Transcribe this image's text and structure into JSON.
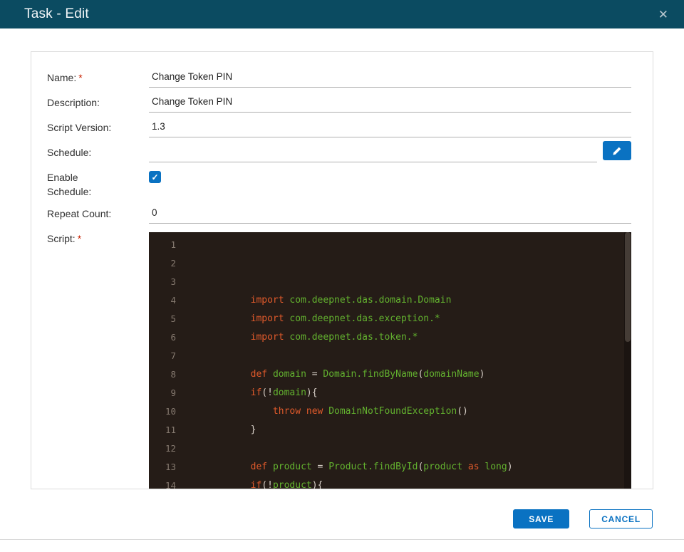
{
  "modal": {
    "title": "Task - Edit",
    "close_glyph": "✕"
  },
  "form": {
    "required_marker": "*",
    "name": {
      "label": "Name:",
      "required": true,
      "value": "Change Token PIN"
    },
    "description": {
      "label": "Description:",
      "value": "Change Token PIN"
    },
    "script_version": {
      "label": "Script Version:",
      "value": "1.3"
    },
    "schedule": {
      "label": "Schedule:",
      "value": ""
    },
    "enable_schedule": {
      "label": "Enable Schedule:",
      "checked": true,
      "check_glyph": "✓"
    },
    "repeat_count": {
      "label": "Repeat Count:",
      "value": "0"
    },
    "script": {
      "label": "Script:",
      "required": true
    }
  },
  "editor": {
    "lines": [
      {
        "num": "1",
        "segments": []
      },
      {
        "num": "2",
        "segments": []
      },
      {
        "num": "3",
        "segments": []
      },
      {
        "num": "4",
        "segments": [
          {
            "t": "p",
            "s": "        "
          },
          {
            "t": "k",
            "s": "import"
          },
          {
            "t": "p",
            "s": " "
          },
          {
            "t": "i",
            "s": "com.deepnet.das.domain.Domain"
          }
        ]
      },
      {
        "num": "5",
        "segments": [
          {
            "t": "p",
            "s": "        "
          },
          {
            "t": "k",
            "s": "import"
          },
          {
            "t": "p",
            "s": " "
          },
          {
            "t": "i",
            "s": "com.deepnet.das.exception.*"
          }
        ]
      },
      {
        "num": "6",
        "segments": [
          {
            "t": "p",
            "s": "        "
          },
          {
            "t": "k",
            "s": "import"
          },
          {
            "t": "p",
            "s": " "
          },
          {
            "t": "i",
            "s": "com.deepnet.das.token.*"
          }
        ]
      },
      {
        "num": "7",
        "segments": []
      },
      {
        "num": "8",
        "segments": [
          {
            "t": "p",
            "s": "        "
          },
          {
            "t": "k",
            "s": "def"
          },
          {
            "t": "p",
            "s": " "
          },
          {
            "t": "i",
            "s": "domain"
          },
          {
            "t": "p",
            "s": " = "
          },
          {
            "t": "i",
            "s": "Domain.findByName"
          },
          {
            "t": "p",
            "s": "("
          },
          {
            "t": "i",
            "s": "domainName"
          },
          {
            "t": "p",
            "s": ")"
          }
        ]
      },
      {
        "num": "9",
        "segments": [
          {
            "t": "p",
            "s": "        "
          },
          {
            "t": "k",
            "s": "if"
          },
          {
            "t": "p",
            "s": "(!"
          },
          {
            "t": "i",
            "s": "domain"
          },
          {
            "t": "p",
            "s": "){"
          }
        ]
      },
      {
        "num": "10",
        "segments": [
          {
            "t": "p",
            "s": "            "
          },
          {
            "t": "k",
            "s": "throw"
          },
          {
            "t": "p",
            "s": " "
          },
          {
            "t": "k",
            "s": "new"
          },
          {
            "t": "p",
            "s": " "
          },
          {
            "t": "i",
            "s": "DomainNotFoundException"
          },
          {
            "t": "p",
            "s": "()"
          }
        ]
      },
      {
        "num": "11",
        "segments": [
          {
            "t": "p",
            "s": "        }"
          }
        ]
      },
      {
        "num": "12",
        "segments": []
      },
      {
        "num": "13",
        "segments": [
          {
            "t": "p",
            "s": "        "
          },
          {
            "t": "k",
            "s": "def"
          },
          {
            "t": "p",
            "s": " "
          },
          {
            "t": "i",
            "s": "product"
          },
          {
            "t": "p",
            "s": " = "
          },
          {
            "t": "i",
            "s": "Product.findById"
          },
          {
            "t": "p",
            "s": "("
          },
          {
            "t": "i",
            "s": "product"
          },
          {
            "t": "p",
            "s": " "
          },
          {
            "t": "k",
            "s": "as"
          },
          {
            "t": "p",
            "s": " "
          },
          {
            "t": "i",
            "s": "long"
          },
          {
            "t": "p",
            "s": ")"
          }
        ]
      },
      {
        "num": "14",
        "segments": [
          {
            "t": "p",
            "s": "        "
          },
          {
            "t": "k",
            "s": "if"
          },
          {
            "t": "p",
            "s": "(!"
          },
          {
            "t": "i",
            "s": "product"
          },
          {
            "t": "p",
            "s": "){"
          }
        ]
      }
    ]
  },
  "footer": {
    "save_label": "SAVE",
    "cancel_label": "CANCEL"
  },
  "colors": {
    "header_bg": "#0b4b61",
    "accent": "#0a72c2",
    "editor_bg": "#251c17",
    "keyword": "#e05a2b",
    "identifier": "#63b22f",
    "required": "#c92100"
  }
}
